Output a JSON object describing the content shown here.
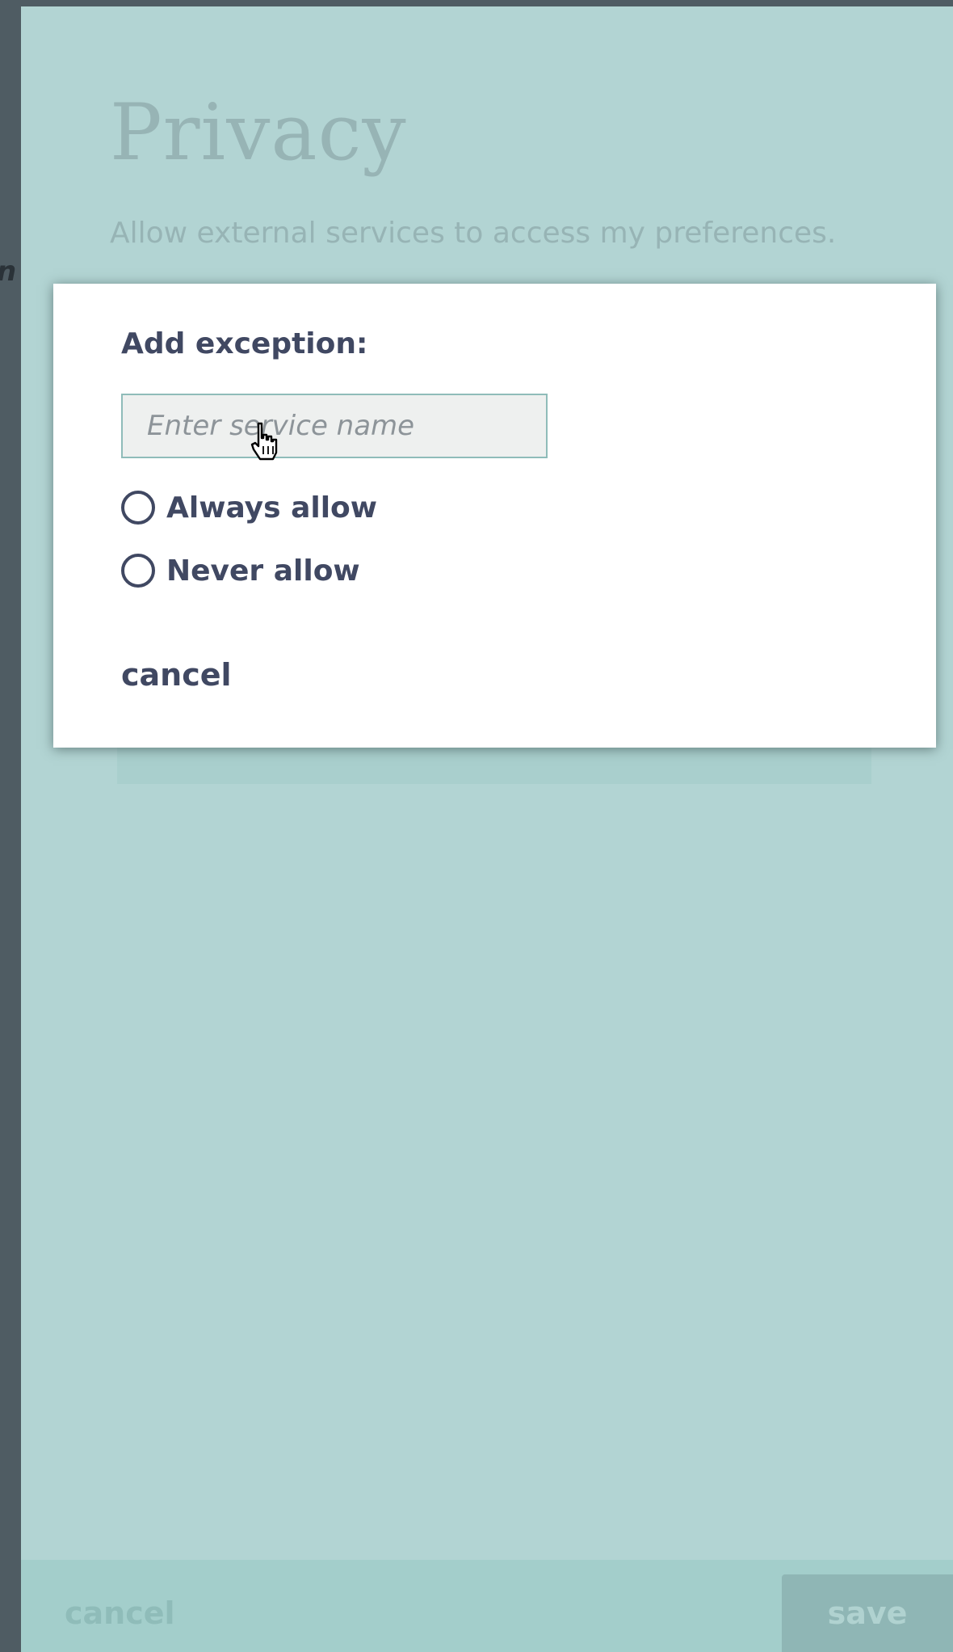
{
  "background": {
    "title": "Privacy",
    "description": "Allow external services to access my preferences.",
    "left_strip_glyph": "n"
  },
  "dialog": {
    "title": "Add exception:",
    "service_input": {
      "placeholder": "Enter service name",
      "value": ""
    },
    "options": [
      {
        "label": "Always allow",
        "selected": false
      },
      {
        "label": "Never allow",
        "selected": false
      }
    ],
    "cancel_label": "cancel"
  },
  "footer": {
    "cancel_label": "cancel",
    "save_label": "save"
  },
  "colors": {
    "panel_bg": "#b2d4d3",
    "dialog_text": "#404862",
    "muted_text": "#97b4b5",
    "frame": "#4f5c63"
  }
}
